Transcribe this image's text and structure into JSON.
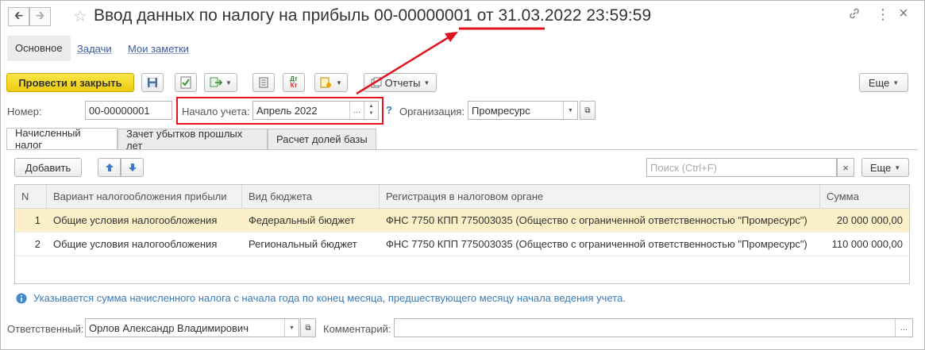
{
  "window": {
    "title": "Ввод данных по налогу на прибыль 00-00000001 от 31.03.2022 23:59:59"
  },
  "sections": [
    "Основное",
    "Задачи",
    "Мои заметки"
  ],
  "toolbar": {
    "post_close": "Провести и закрыть",
    "reports": "Отчеты",
    "more": "Еще"
  },
  "header": {
    "number_label": "Номер:",
    "number_value": "00-00000001",
    "start_label": "Начало учета:",
    "start_value": "Апрель 2022",
    "org_label": "Организация:",
    "org_value": "Промресурс",
    "help": "?"
  },
  "tabs": [
    "Начисленный налог",
    "Зачет убытков прошлых лет",
    "Расчет долей базы"
  ],
  "table_toolbar": {
    "add": "Добавить",
    "search_placeholder": "Поиск (Ctrl+F)",
    "more": "Еще"
  },
  "table": {
    "columns": [
      "N",
      "Вариант налогообложения прибыли",
      "Вид бюджета",
      "Регистрация в налоговом органе",
      "Сумма"
    ],
    "rows": [
      [
        "1",
        "Общие условия налогообложения",
        "Федеральный бюджет",
        "ФНС 7750 КПП 775003035 (Общество с ограниченной ответственностью \"Промресурс\")",
        "20 000 000,00"
      ],
      [
        "2",
        "Общие условия налогообложения",
        "Региональный бюджет",
        "ФНС 7750 КПП 775003035 (Общество с ограниченной ответственностью \"Промресурс\")",
        "110 000 000,00"
      ]
    ]
  },
  "hint": "Указывается сумма начисленного налога с начала года по конец месяца, предшествующего месяцу начала ведения учета.",
  "footer": {
    "responsible_label": "Ответственный:",
    "responsible_value": "Орлов Александр Владимирович",
    "comment_label": "Комментарий:",
    "comment_value": ""
  },
  "colors": {
    "accent_yellow": "#f3d526",
    "highlight_red": "#e0141e",
    "selected_row": "#fbf0c8",
    "link_blue": "#3b5a9a"
  }
}
